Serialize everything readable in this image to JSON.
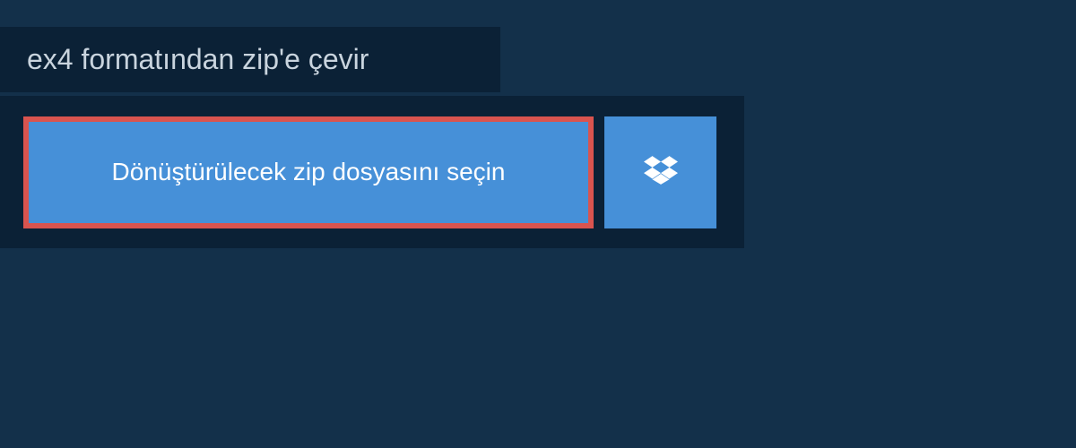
{
  "header": {
    "title": "ex4 formatından zip'e çevir"
  },
  "panel": {
    "select_file_label": "Dönüştürülecek zip dosyasını seçin"
  },
  "colors": {
    "page_bg": "#13304a",
    "panel_bg": "#0b2136",
    "button_bg": "#4690d8",
    "highlight_border": "#d9544f",
    "text_light": "#c9d4de",
    "text_white": "#ffffff"
  }
}
